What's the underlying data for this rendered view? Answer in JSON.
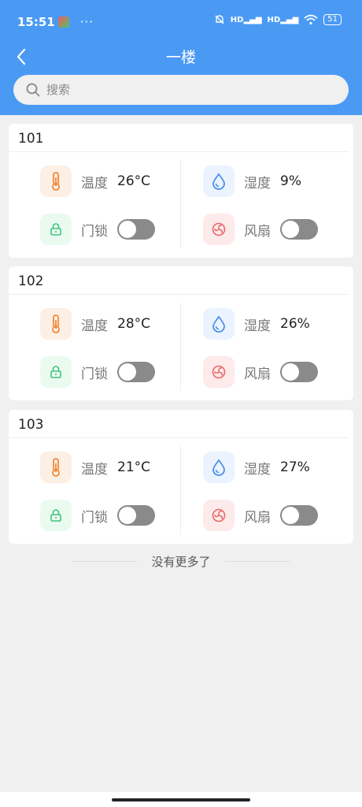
{
  "status": {
    "time": "15:51",
    "dots": "···",
    "signal1": "HD",
    "signal2": "HD",
    "battery": "51"
  },
  "nav": {
    "title": "一楼"
  },
  "search": {
    "placeholder": "搜索"
  },
  "rooms": [
    {
      "name": "101",
      "temp_label": "温度",
      "temp_value": "26°C",
      "hum_label": "湿度",
      "hum_value": "9%",
      "lock_label": "门锁",
      "lock_on": false,
      "fan_label": "风扇",
      "fan_on": false
    },
    {
      "name": "102",
      "temp_label": "温度",
      "temp_value": "28°C",
      "hum_label": "湿度",
      "hum_value": "26%",
      "lock_label": "门锁",
      "lock_on": false,
      "fan_label": "风扇",
      "fan_on": false
    },
    {
      "name": "103",
      "temp_label": "温度",
      "temp_value": "21°C",
      "hum_label": "湿度",
      "hum_value": "27%",
      "lock_label": "门锁",
      "lock_on": false,
      "fan_label": "风扇",
      "fan_on": false
    }
  ],
  "footer": {
    "no_more": "没有更多了"
  },
  "colors": {
    "header": "#4a9af4",
    "temp_icon": "#f0883a",
    "hum_icon": "#4a8fe8",
    "lock_icon": "#3fc47a",
    "fan_icon": "#e86a6a",
    "toggle_off": "#8a8a8a"
  },
  "icons": {
    "back": "chevron-left-icon",
    "search": "search-icon",
    "temp": "thermometer-icon",
    "hum": "water-drop-icon",
    "lock": "lock-icon",
    "fan": "fan-icon"
  }
}
